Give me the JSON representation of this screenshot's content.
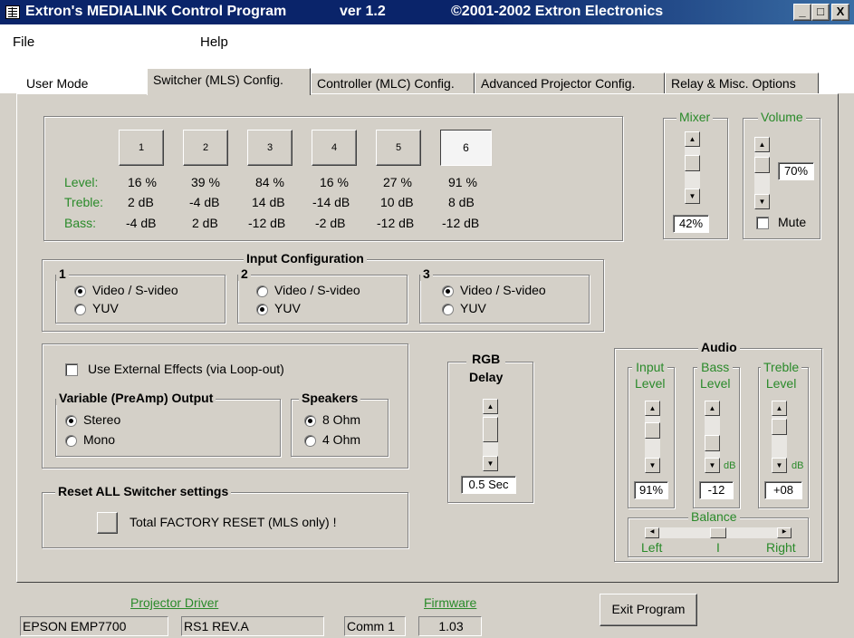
{
  "title_bar": {
    "title": "Extron's MEDIALINK Control Program",
    "version": "ver 1.2",
    "copyright": "©2001-2002 Extron Electronics",
    "minimize": "_",
    "maximize": "□",
    "close": "X"
  },
  "menu": [
    "File",
    "Help"
  ],
  "tabs": [
    "User Mode",
    "Switcher (MLS) Config.",
    "Controller (MLC) Config.",
    "Advanced Projector Config.",
    "Relay & Misc. Options"
  ],
  "active_tab": "Switcher (MLS) Config.",
  "channels": {
    "row_labels": {
      "level": "Level:",
      "treble": "Treble:",
      "bass": "Bass:"
    },
    "items": [
      {
        "button": "1",
        "level": "16 %",
        "treble": "2 dB",
        "bass": "-4 dB"
      },
      {
        "button": "2",
        "level": "39 %",
        "treble": "-4 dB",
        "bass": "2 dB"
      },
      {
        "button": "3",
        "level": "84 %",
        "treble": "14 dB",
        "bass": "-12 dB"
      },
      {
        "button": "4",
        "level": "16 %",
        "treble": "-14 dB",
        "bass": "-2 dB"
      },
      {
        "button": "5",
        "level": "27 %",
        "treble": "10 dB",
        "bass": "-12 dB"
      },
      {
        "button": "6",
        "level": "91 %",
        "treble": "8 dB",
        "bass": "-12 dB"
      }
    ],
    "selected": "6"
  },
  "mixer": {
    "label": "Mixer",
    "value": "42%",
    "level": 0.42
  },
  "volume": {
    "label": "Volume",
    "value": "70%",
    "level": 0.7,
    "mute_label": "Mute",
    "muted": false
  },
  "input_config": {
    "title": "Input Configuration",
    "groups": [
      {
        "label": "1",
        "opt1": "Video / S-video",
        "opt2": "YUV",
        "selected": "Video / S-video"
      },
      {
        "label": "2",
        "opt1": "Video / S-video",
        "opt2": "YUV",
        "selected": "YUV"
      },
      {
        "label": "3",
        "opt1": "Video / S-video",
        "opt2": "YUV",
        "selected": "Video / S-video"
      }
    ]
  },
  "effects": {
    "external_label": "Use External Effects (via Loop-out)",
    "external_checked": false,
    "preamp": {
      "title": "Variable (PreAmp) Output",
      "opt1": "Stereo",
      "opt2": "Mono",
      "selected": "Stereo"
    },
    "speakers": {
      "title": "Speakers",
      "opt1": "8 Ohm",
      "opt2": "4 Ohm",
      "selected": "8 Ohm"
    }
  },
  "reset": {
    "title": "Reset ALL Switcher settings",
    "label": "Total FACTORY RESET (MLS only) !"
  },
  "rgb_delay": {
    "title1": "RGB",
    "title2": "Delay",
    "value": "0.5 Sec"
  },
  "audio": {
    "title": "Audio",
    "input": {
      "title1": "Input",
      "title2": "Level",
      "value": "91%"
    },
    "bass": {
      "title1": "Bass",
      "title2": "Level",
      "value": "-12",
      "unit": "dB"
    },
    "treble": {
      "title1": "Treble",
      "title2": "Level",
      "value": "+08",
      "unit": "dB"
    },
    "balance": {
      "title": "Balance",
      "left": "Left",
      "center": "I",
      "right": "Right"
    }
  },
  "status": {
    "projector_driver_label": "Projector Driver",
    "projector": "EPSON EMP7700",
    "revision": "RS1 REV.A",
    "comm": "Comm 1",
    "firmware_label": "Firmware",
    "firmware": "1.03"
  },
  "exit_button": "Exit Program",
  "colors": {
    "title_blue": "#0a246a",
    "label_green": "#2a8a2a",
    "face": "#d4d0c8"
  }
}
